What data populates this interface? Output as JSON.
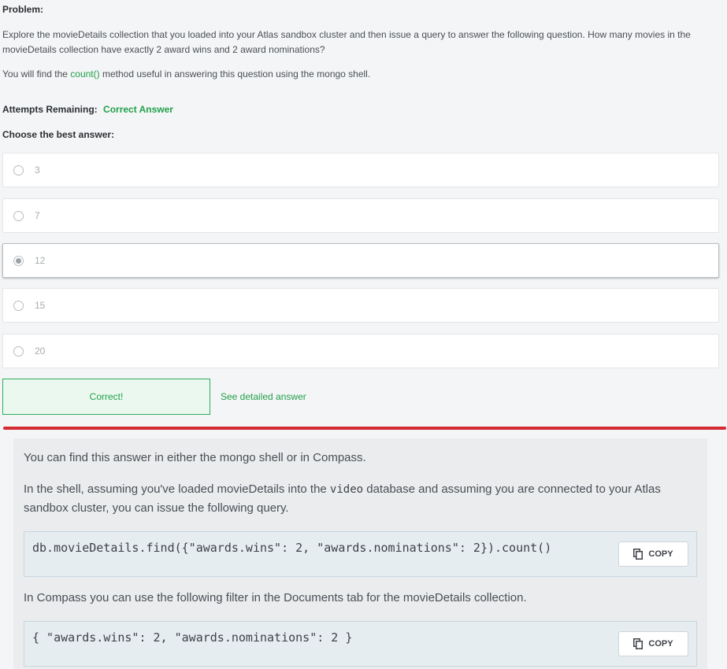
{
  "problem": {
    "title": "Problem:",
    "text": "Explore the movieDetails collection that you loaded into your Atlas sandbox cluster and then issue a query to answer the following question. How many movies in the movieDetails collection have exactly 2 award wins and 2 award nominations?",
    "hint_before": "You will find the ",
    "hint_code": "count()",
    "hint_after": " method useful in answering this question using the mongo shell."
  },
  "attempts": {
    "label": "Attempts Remaining:",
    "status": "Correct Answer"
  },
  "choose_label": "Choose the best answer:",
  "options": [
    {
      "label": "3",
      "selected": false
    },
    {
      "label": "7",
      "selected": false
    },
    {
      "label": "12",
      "selected": true
    },
    {
      "label": "15",
      "selected": false
    },
    {
      "label": "20",
      "selected": false
    }
  ],
  "result": {
    "message": "Correct!",
    "detail_link": "See detailed answer"
  },
  "answer": {
    "para1": "You can find this answer in either the mongo shell or in Compass.",
    "para2_before": "In the shell, assuming you've loaded movieDetails into the ",
    "para2_code": "video",
    "para2_after": " database and assuming you are connected to your Atlas sandbox cluster, you can issue the following query.",
    "code1": "db.movieDetails.find({\"awards.wins\": 2, \"awards.nominations\": 2}).count()",
    "para3": "In Compass you can use the following filter in the Documents tab for the movieDetails collection.",
    "code2": "{ \"awards.wins\": 2, \"awards.nominations\": 2 }",
    "copy_label": "COPY"
  },
  "colors": {
    "accent_green": "#22a04a",
    "divider_red": "#d42b35"
  },
  "icons": {
    "copy": "copy-icon",
    "radio": "radio-icon"
  }
}
